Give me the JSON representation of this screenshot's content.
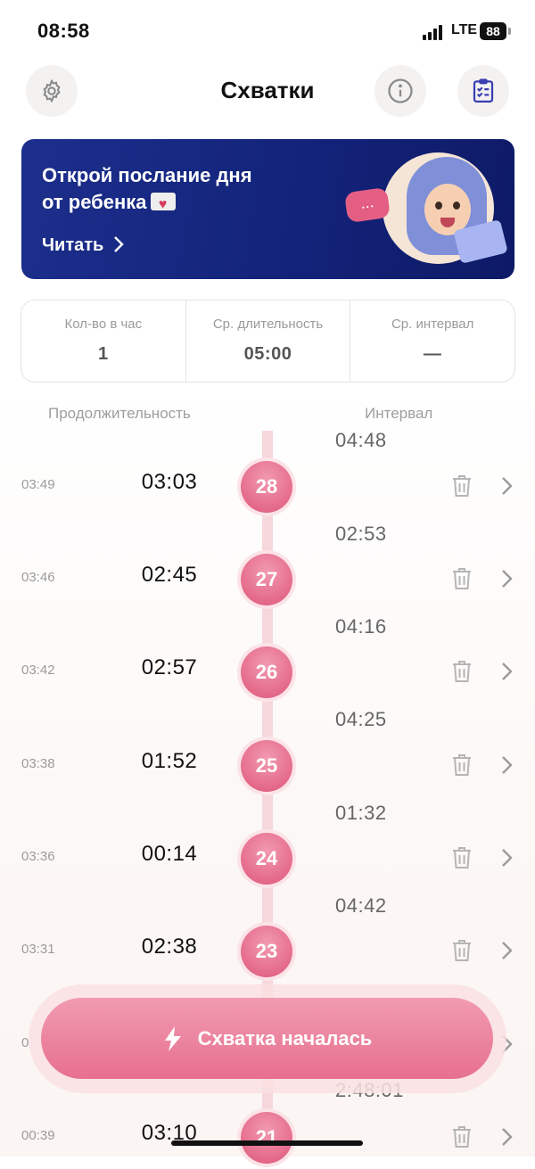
{
  "status_bar": {
    "time": "08:58",
    "network": "LTE",
    "battery": "88"
  },
  "header": {
    "title": "Схватки",
    "icons": [
      "gear-icon",
      "info-icon",
      "clipboard-check-icon"
    ]
  },
  "banner": {
    "line1": "Открой послание дня",
    "line2": "от ребенка",
    "link": "Читать",
    "bubble": "..."
  },
  "stats": [
    {
      "label": "Кол-во в час",
      "value": "1"
    },
    {
      "label": "Ср. длительность",
      "value": "05:00"
    },
    {
      "label": "Ср. интервал",
      "value": "—"
    }
  ],
  "columns": {
    "duration": "Продолжительность",
    "interval": "Интервал"
  },
  "intervals": [
    "04:48",
    "02:53",
    "04:16",
    "04:25",
    "01:32",
    "04:42",
    "2:48:01"
  ],
  "contractions": [
    {
      "time": "03:49",
      "duration": "03:03",
      "number": "28"
    },
    {
      "time": "03:46",
      "duration": "02:45",
      "number": "27"
    },
    {
      "time": "03:42",
      "duration": "02:57",
      "number": "26"
    },
    {
      "time": "03:38",
      "duration": "01:52",
      "number": "25"
    },
    {
      "time": "03:36",
      "duration": "00:14",
      "number": "24"
    },
    {
      "time": "03:31",
      "duration": "02:38",
      "number": "23"
    },
    {
      "time": "0",
      "duration": "",
      "number": ""
    },
    {
      "time": "00:39",
      "duration": "03:10",
      "number": "21"
    }
  ],
  "cta": {
    "label": "Схватка началась",
    "icon": "lightning-icon"
  }
}
